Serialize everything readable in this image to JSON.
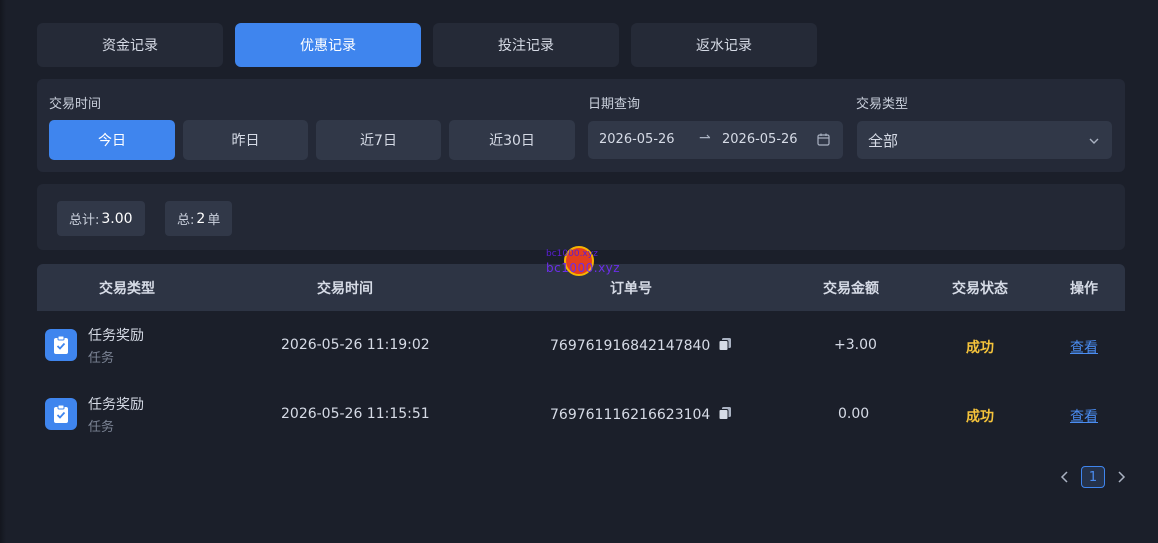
{
  "tabs": [
    {
      "label": "资金记录",
      "active": false
    },
    {
      "label": "优惠记录",
      "active": true
    },
    {
      "label": "投注记录",
      "active": false
    },
    {
      "label": "返水记录",
      "active": false
    }
  ],
  "filter": {
    "time_label": "交易时间",
    "quick": [
      "今日",
      "昨日",
      "近7日",
      "近30日"
    ],
    "quick_active": "今日",
    "date_label": "日期查询",
    "date_start": "2026-05-26",
    "date_arrow": "⇀",
    "date_end": "2026-05-26",
    "type_label": "交易类型",
    "type_value": "全部"
  },
  "summary": {
    "total_label": "总计: ",
    "total_value": "3.00",
    "count_label": "总: ",
    "count_value": "2",
    "count_unit": " 单"
  },
  "table": {
    "headers": [
      "交易类型",
      "交易时间",
      "订单号",
      "交易金额",
      "交易状态",
      "操作"
    ],
    "rows": [
      {
        "type": "任务奖励",
        "subtype": "任务",
        "time": "2026-05-26 11:19:02",
        "order": "769761916842147840",
        "amount": "+3.00",
        "status": "成功",
        "action": "查看"
      },
      {
        "type": "任务奖励",
        "subtype": "任务",
        "time": "2026-05-26 11:15:51",
        "order": "769761116216623104",
        "amount": "0.00",
        "status": "成功",
        "action": "查看"
      }
    ]
  },
  "pagination": {
    "current": "1"
  },
  "watermark": {
    "line1": "bc1000.xyz",
    "line2": "bc1000.xyz"
  },
  "colors": {
    "accent": "#3f85ee",
    "success": "#f5c33b",
    "link": "#4a8cf0",
    "bg": "#1b1f2a"
  }
}
